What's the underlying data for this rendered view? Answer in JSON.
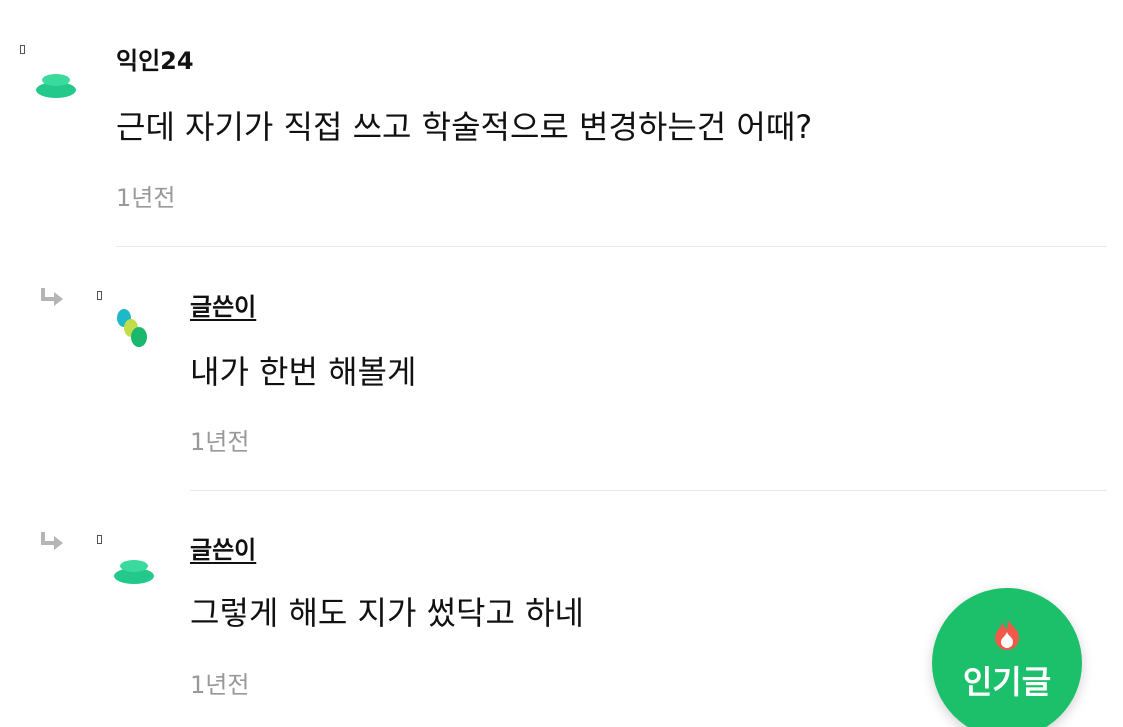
{
  "comments": [
    {
      "author": "익인24",
      "author_is_op": false,
      "avatar": "green-blob-avatar",
      "text": "근데 자기가 직접 쓰고 학술적으로 변경하는건 어때?",
      "time": "1년전",
      "is_reply": false
    },
    {
      "author": "글쓴이",
      "author_is_op": true,
      "avatar": "colored-dots-avatar",
      "text": "내가 한번 해볼게",
      "time": "1년전",
      "is_reply": true
    },
    {
      "author": "글쓴이",
      "author_is_op": true,
      "avatar": "green-blob-avatar",
      "text": "그렇게 해도 지가 썼닥고 하네",
      "time": "1년전",
      "is_reply": true
    }
  ],
  "fab": {
    "label": "인기글",
    "icon": "fire-icon",
    "color": "#1cc06a"
  },
  "colors": {
    "avatar_green": "#22c98b",
    "time_gray": "#999999",
    "divider": "#e8e8e8"
  }
}
